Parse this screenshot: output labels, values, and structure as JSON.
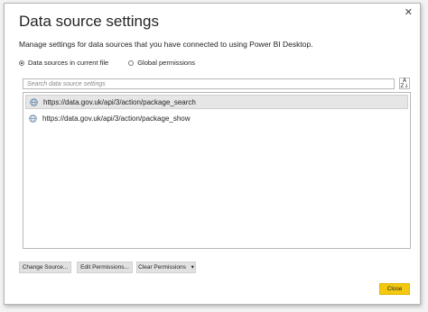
{
  "dialog": {
    "close_glyph": "✕",
    "title": "Data source settings",
    "description": "Manage settings for data sources that you have connected to using Power BI Desktop."
  },
  "scope": {
    "option_current": "Data sources in current file",
    "option_global": "Global permissions",
    "selected": "current"
  },
  "search": {
    "placeholder": "Search data source settings"
  },
  "sources": [
    {
      "url": "https://data.gov.uk/api/3/action/package_search",
      "selected": true,
      "icon": "globe-icon"
    },
    {
      "url": "https://data.gov.uk/api/3/action/package_show",
      "selected": false,
      "icon": "globe-icon"
    }
  ],
  "buttons": {
    "change_source": "Change Source...",
    "edit_permissions": "Edit Permissions...",
    "clear_permissions": "Clear Permissions",
    "dropdown_glyph": "▾",
    "close": "Close"
  },
  "colors": {
    "accent": "#f2c811",
    "selection": "#e6e6e6",
    "globe": "#5b7fa6"
  }
}
